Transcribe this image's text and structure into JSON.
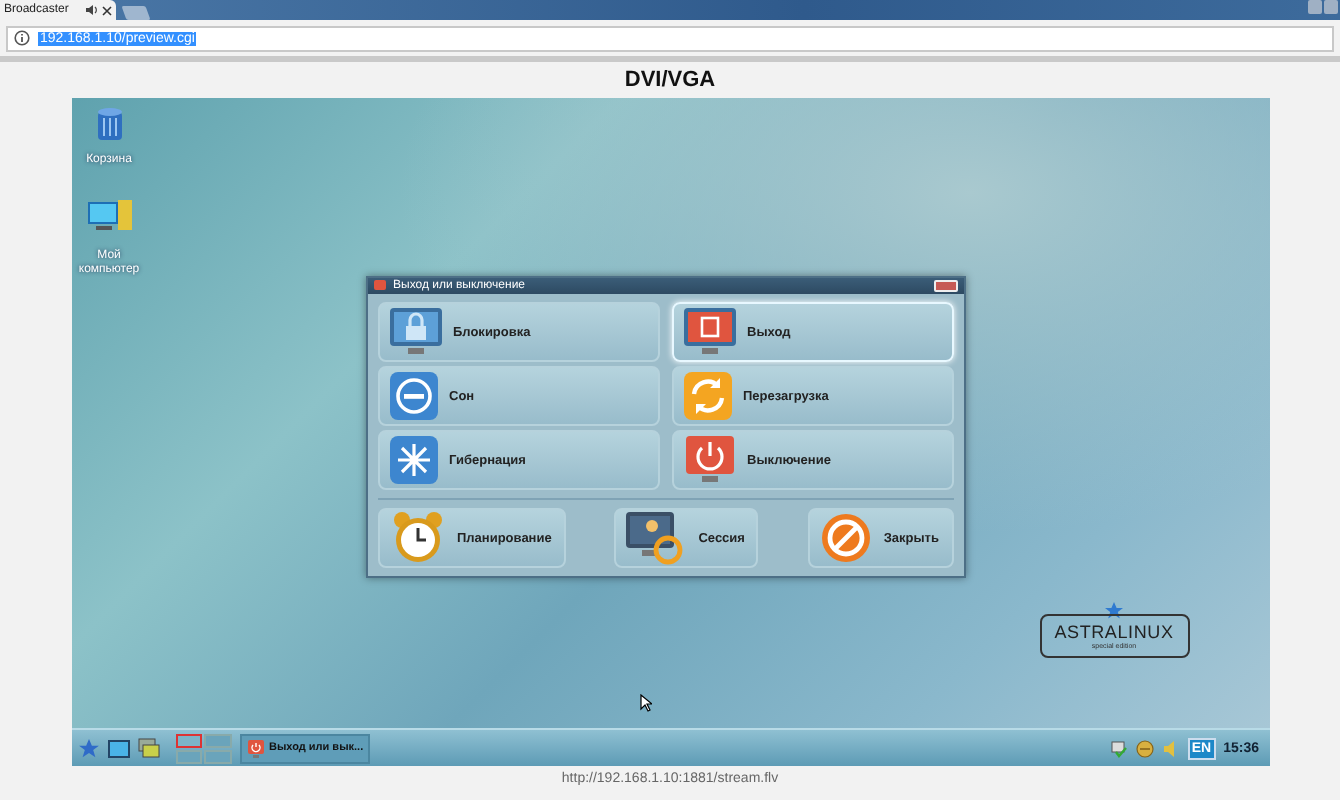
{
  "browser": {
    "tab": {
      "title": "Broadcaster"
    },
    "address": {
      "value": "192.168.1.10/preview.cgi"
    }
  },
  "page": {
    "title": "DVI/VGA",
    "footer_link": "http://192.168.1.10:1881/stream.flv"
  },
  "desktop": {
    "icons": [
      {
        "label": "Корзина",
        "kind": "trash"
      },
      {
        "label": "Мой компьютер",
        "kind": "computer"
      }
    ],
    "dialog": {
      "title": "Выход или выключение",
      "actions": [
        {
          "label": "Блокировка",
          "kind": "lock",
          "selected": false
        },
        {
          "label": "Выход",
          "kind": "logout",
          "selected": true
        },
        {
          "label": "Сон",
          "kind": "sleep",
          "selected": false
        },
        {
          "label": "Перезагрузка",
          "kind": "reboot",
          "selected": false
        },
        {
          "label": "Гибернация",
          "kind": "hibernate",
          "selected": false
        },
        {
          "label": "Выключение",
          "kind": "shutdown",
          "selected": false
        }
      ],
      "bottom_actions": [
        {
          "label": "Планирование",
          "kind": "schedule"
        },
        {
          "label": "Сессия",
          "kind": "session"
        },
        {
          "label": "Закрыть",
          "kind": "close"
        }
      ]
    },
    "logo": {
      "name": "ASTRALINUX",
      "tagline": "special edition"
    },
    "taskbar": {
      "workspaces": [
        {
          "selected": true
        },
        {
          "selected": false
        },
        {
          "selected": false
        },
        {
          "selected": false
        }
      ],
      "tasks": [
        {
          "label": "Выход или вык..."
        }
      ],
      "language": "EN",
      "clock": "15:36"
    }
  }
}
